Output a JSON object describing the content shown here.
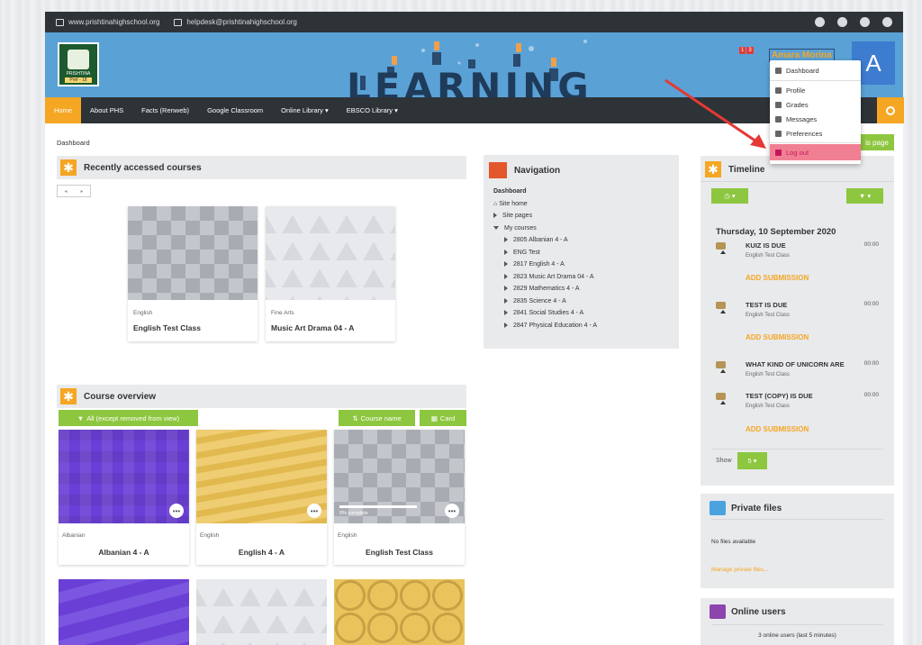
{
  "topbar": {
    "website": "www.prishtinahighschool.org",
    "email": "helpdesk@prishtinahighschool.org"
  },
  "banner": {
    "logo_text": "PRISHTINA",
    "logo_sub": "Pref - 18",
    "hero_text": "LEARNING"
  },
  "user": {
    "name": "Amara Morina",
    "avatar": "A",
    "badges": [
      "1",
      "3"
    ]
  },
  "navbar": {
    "items": [
      "Home",
      "About PHS",
      "Facts (Renweb)",
      "Google Classroom",
      "Online Library ▾",
      "EBSCO Library ▾"
    ]
  },
  "breadcrumb": "Dashboard",
  "customise_btn": "is page",
  "recent": {
    "title": "Recently accessed courses",
    "prev": "◂",
    "next": "▸",
    "cards": [
      {
        "category": "English",
        "name": "English Test Class"
      },
      {
        "category": "Fine Arts",
        "name": "Music Art Drama 04 - A"
      }
    ]
  },
  "overview": {
    "title": "Course overview",
    "filter": "All (except removed from view)",
    "sort": "Course name",
    "view": "Card",
    "cards": [
      {
        "category": "Albanian",
        "name": "Albanian 4 - A",
        "progress": null
      },
      {
        "category": "English",
        "name": "English 4 - A",
        "progress": null
      },
      {
        "category": "English",
        "name": "English Test Class",
        "progress": "0% complete"
      }
    ]
  },
  "navigation": {
    "title": "Navigation",
    "root": "Dashboard",
    "site_home": "Site home",
    "site_pages": "Site pages",
    "my_courses": "My courses",
    "courses": [
      "2805 Albanian 4 - A",
      "ENG Test",
      "2817 English 4 - A",
      "2823 Music Art Drama 04 - A",
      "2829 Mathematics 4 - A",
      "2835 Science 4 - A",
      "2841 Social Studies 4 - A",
      "2847 Physical Education 4 - A"
    ]
  },
  "timeline": {
    "title": "Timeline",
    "date": "Thursday, 10 September 2020",
    "items": [
      {
        "title": "KUIZ IS DUE",
        "sub": "English Test Class",
        "time": "00:00",
        "action": "ADD SUBMISSION"
      },
      {
        "title": "TEST IS DUE",
        "sub": "English Test Class",
        "time": "00:00",
        "action": "ADD SUBMISSION"
      },
      {
        "title": "WHAT KIND OF UNICORN ARE",
        "sub": "English Test Class",
        "time": "00:00",
        "action": ""
      },
      {
        "title": "TEST (COPY) IS DUE",
        "sub": "English Test Class",
        "time": "00:00",
        "action": "ADD SUBMISSION"
      }
    ],
    "show_label": "Show",
    "show_value": "5 ▾"
  },
  "private_files": {
    "title": "Private files",
    "empty": "No files available",
    "manage": "Manage private files..."
  },
  "online_users": {
    "title": "Online users",
    "count": "3 online users (last 5 minutes)"
  },
  "user_menu": {
    "items": [
      "Dashboard",
      "Profile",
      "Grades",
      "Messages",
      "Preferences",
      "Log out"
    ]
  },
  "colors": {
    "accent": "#f5a623",
    "green": "#8dc63f",
    "dark": "#2e3338",
    "banner": "#5aa1d6",
    "logout": "#f17f93"
  }
}
